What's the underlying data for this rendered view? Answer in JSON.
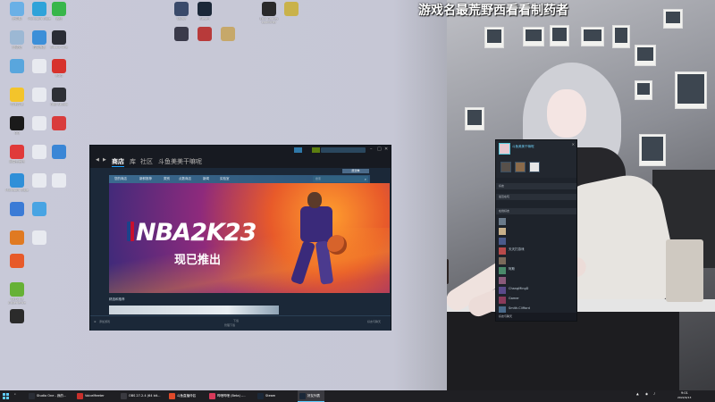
{
  "overlay_text": "游戏名最荒野西看看制药者",
  "desktop_icons": [
    {
      "label": "此电脑",
      "color": "#6ab0e6"
    },
    {
      "label": "Microsoft Edge",
      "color": "#2fa3d9"
    },
    {
      "label": "微信",
      "color": "#38b64a"
    },
    {
      "label": "回收站",
      "color": "#9cb8d4"
    },
    {
      "label": "控制面板",
      "color": "#3c8fd8"
    },
    {
      "label": "Studio One",
      "color": "#2a2d35"
    },
    {
      "label": "",
      "color": "#59a6dd"
    },
    {
      "label": "",
      "color": "#e8eaf0"
    },
    {
      "label": "ROG",
      "color": "#d7322c"
    },
    {
      "label": "哔哩哔哩",
      "color": "#f3c42b"
    },
    {
      "label": "",
      "color": "#e8eaf0"
    },
    {
      "label": "OBS Studio",
      "color": "#2d2f35"
    },
    {
      "label": "QQ",
      "color": "#1a1a1a"
    },
    {
      "label": "",
      "color": "#e8eaf0"
    },
    {
      "label": "",
      "color": "#d93c3c"
    },
    {
      "label": "网易云音乐",
      "color": "#e03a3a"
    },
    {
      "label": "",
      "color": "#e8eaf0"
    },
    {
      "label": "",
      "color": "#3a86d6"
    },
    {
      "label": "Microsoft Edge",
      "color": "#2f8fd8"
    },
    {
      "label": "",
      "color": "#e8eaf0"
    },
    {
      "label": "",
      "color": "#e8eaf0"
    },
    {
      "label": "",
      "color": "#3b7bd6"
    },
    {
      "label": "",
      "color": "#48a4e3"
    },
    {
      "label": "",
      "color": "#e07a22"
    },
    {
      "label": "",
      "color": "#e8eaf0"
    },
    {
      "label": "",
      "color": "#e75a2a"
    },
    {
      "label": "GeForce Experience",
      "color": "#66b135"
    },
    {
      "label": "",
      "color": "#2b2b2b"
    },
    {
      "label": "Uplay",
      "color": "#3a4a6a"
    },
    {
      "label": "Steam",
      "color": "#1b2838"
    },
    {
      "label": "Epic Games Launcher",
      "color": "#2a2a2a"
    },
    {
      "label": "",
      "color": "#c9b24a"
    },
    {
      "label": "",
      "color": "#3a3a4a"
    },
    {
      "label": "",
      "color": "#b83a3a"
    },
    {
      "label": "",
      "color": "#c6a86a"
    }
  ],
  "steam": {
    "nav_store": "商店",
    "nav_library": "库",
    "nav_community": "社区",
    "nav_user": "斗鱼美美干嘛呢",
    "wishlist": "愿望单",
    "menu": [
      "您的商店",
      "新鲜推荐",
      "类别",
      "点数商店",
      "新闻",
      "实验室"
    ],
    "search_placeholder": "搜索",
    "banner_title": "NBA2K23",
    "banner_subtitle": "现已推出",
    "featured_label": "精选和推荐",
    "footer_add_game": "添加游戏",
    "footer_downloads": "下载",
    "footer_manage": "管理下载",
    "footer_friends": "好友与聊天"
  },
  "friends": {
    "username": "斗鱼美美干嘛呢",
    "section_friends": "好友",
    "section_recent": "最近在玩",
    "section_online": "在线好友",
    "rows": [
      {
        "name": "",
        "status": ""
      },
      {
        "name": "",
        "status": ""
      },
      {
        "name": "",
        "status": ""
      },
      {
        "name": "天天打游戏",
        "status": ""
      },
      {
        "name": "",
        "status": ""
      },
      {
        "name": "阿斯",
        "status": ""
      },
      {
        "name": "",
        "status": ""
      },
      {
        "name": "ChangMingD",
        "status": ""
      },
      {
        "name": "Gamer",
        "status": ""
      },
      {
        "name": "Smith.Clifford",
        "status": ""
      }
    ],
    "bottom_label": "好友与聊天"
  },
  "taskbar": {
    "items": [
      {
        "label": "Studio One - 我的...",
        "color": "#2a2d35"
      },
      {
        "label": "VoiceMeeter",
        "color": "#c9302c"
      },
      {
        "label": "OBS 27.2.4 (64 bit...",
        "color": "#3a3a40"
      },
      {
        "label": "斗鱼直播伴侣",
        "color": "#e04a2a"
      },
      {
        "label": "哔哩哔哩 (Beta) -...",
        "color": "#d83a5a"
      },
      {
        "label": "Steam",
        "color": "#1b2838"
      },
      {
        "label": "好友列表",
        "color": "#1b2838"
      }
    ],
    "tray_time": "9:01",
    "tray_date": "2022/9/13"
  }
}
